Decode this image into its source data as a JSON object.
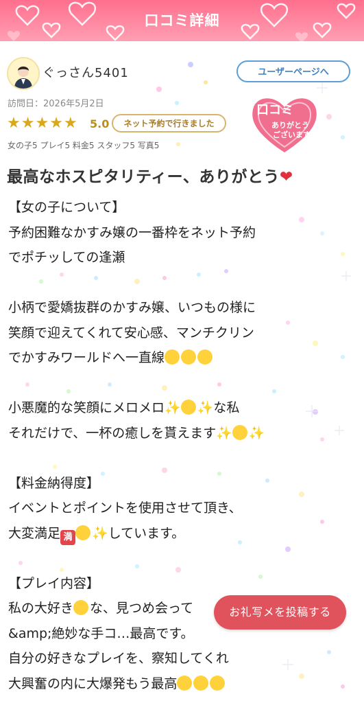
{
  "header": {
    "title": "口コミ詳細"
  },
  "reviewer": {
    "name": "ぐっさん5401",
    "user_page_label": "ユーザーページへ",
    "visit_date": "訪問日：2026年5月2日",
    "rating": "5.0",
    "stars": 5,
    "net_reservation_badge": "ネット予約で行きました",
    "scores": "女の子5 プレイ5 料金5 スタッフ5 写真5"
  },
  "stamp": {
    "line1": "口コミ",
    "line2": "ありがとう",
    "line3": "ございます"
  },
  "review": {
    "title": "最高なホスピタリティー、ありがとう",
    "lines": [
      "【女の子について】",
      "予約困難なかすみ嬢の一番枠をネット予約",
      "でポチッしての逢瀬",
      "",
      "小柄で愛嬌抜群のかすみ嬢、いつもの様に",
      "笑顔で迎えてくれて安心感、マンチクリン",
      "でかすみワールドへ一直線",
      "",
      "小悪魔的な笑顔にメロメロ",
      "それだけで、一杯の癒しを貰えます",
      "",
      "【料金納得度】",
      "イベントとポイントを使用させて頂き、",
      "大変満足",
      "",
      "【プレイ内容】",
      "私の大好き",
      "&amp;絶妙な手コ…最高です。",
      "自分の好きなプレイを、察知してくれ",
      "大興奮の内に大爆発もう最高"
    ],
    "line9_mid": "な私",
    "line14_tail": "しています。",
    "line17_tail": "な、見つめ会って",
    "manten_label": "満"
  },
  "post_button": {
    "label": "お礼写メを投稿する"
  },
  "colors": {
    "header": "#ff7f9a",
    "accent": "#e0535d",
    "link_blue": "#3f7fc2",
    "star_gold": "#d9a81e"
  }
}
